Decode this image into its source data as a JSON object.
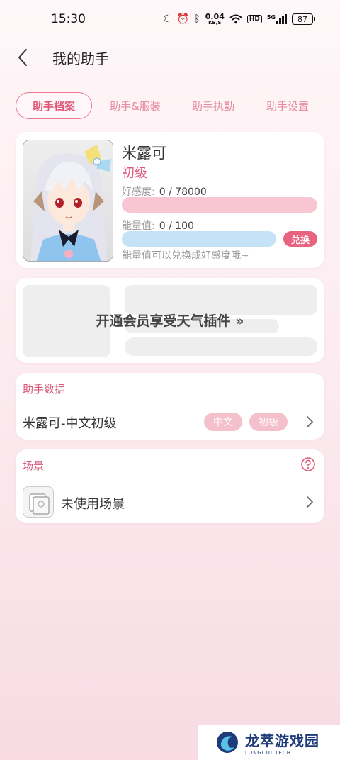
{
  "status": {
    "time": "15:30",
    "net_speed_value": "0.04",
    "net_speed_unit": "KB/S",
    "hd_label": "HD",
    "signal_label": "5G",
    "battery": "87"
  },
  "header": {
    "title": "我的助手"
  },
  "tabs": [
    {
      "label": "助手档案",
      "active": true
    },
    {
      "label": "助手&服装"
    },
    {
      "label": "助手执勤"
    },
    {
      "label": "助手设置"
    }
  ],
  "profile": {
    "name": "米露可",
    "level": "初级",
    "favor_label": "好感度:",
    "favor_value": "0 / 78000",
    "energy_label": "能量值:",
    "energy_value": "0 / 100",
    "exchange_label": "兑换",
    "energy_hint": "能量值可以兑换成好感度哦~"
  },
  "vip": {
    "promo": "开通会员享受天气插件 »"
  },
  "assistant_data": {
    "section_title": "助手数据",
    "row_label": "米露可-中文初级",
    "tag_language": "中文",
    "tag_level": "初级"
  },
  "scene": {
    "section_title": "场景",
    "row_label": "未使用场景"
  },
  "watermark": {
    "title": "龙萃游戏园",
    "subtitle": "LONGCUI TECH"
  },
  "colors": {
    "accent": "#e0577a",
    "favor_bar": "#f7c6d2",
    "energy_bar": "#c6e2f7",
    "exchange_button": "#e8637f"
  }
}
